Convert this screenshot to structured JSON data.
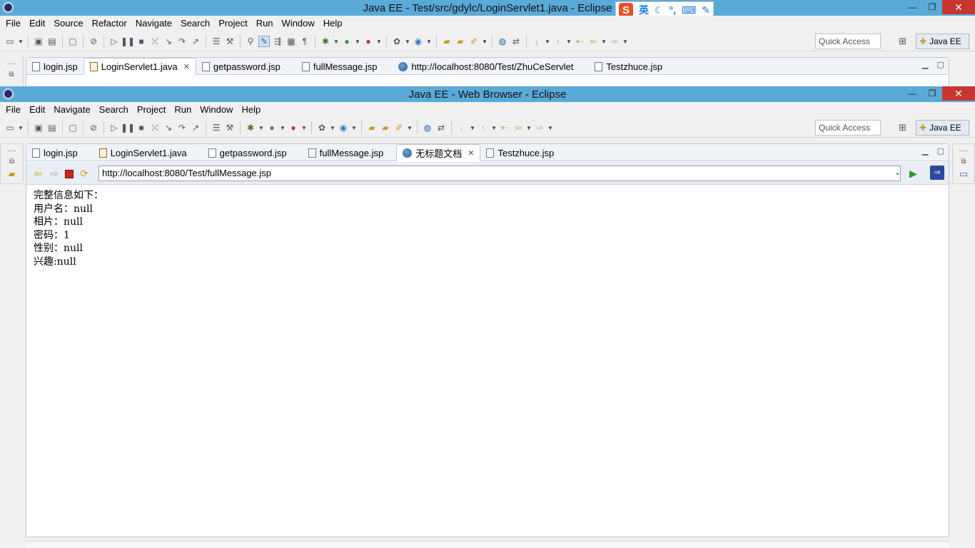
{
  "back_window": {
    "title": "Java EE - Test/src/gdylc/LoginServlet1.java - Eclipse",
    "menu": [
      "File",
      "Edit",
      "Source",
      "Refactor",
      "Navigate",
      "Search",
      "Project",
      "Run",
      "Window",
      "Help"
    ],
    "quick_access": "Quick Access",
    "perspective": "Java EE",
    "tabs": [
      {
        "label": "login.jsp",
        "icon": "jsp-file-icon"
      },
      {
        "label": "LoginServlet1.java",
        "icon": "java-file-icon",
        "active": true
      },
      {
        "label": "getpassword.jsp",
        "icon": "jsp-file-icon"
      },
      {
        "label": "fullMessage.jsp",
        "icon": "jsp-file-icon"
      },
      {
        "label": "http://localhost:8080/Test/ZhuCeServlet",
        "icon": "globe-icon"
      },
      {
        "label": "Testzhuce.jsp",
        "icon": "jsp-file-icon"
      }
    ]
  },
  "ime": {
    "label": "英",
    "logo": "S"
  },
  "front_window": {
    "title": "Java EE - Web Browser - Eclipse",
    "menu": [
      "File",
      "Edit",
      "Navigate",
      "Search",
      "Project",
      "Run",
      "Window",
      "Help"
    ],
    "quick_access": "Quick Access",
    "perspective": "Java EE",
    "tabs": [
      {
        "label": "login.jsp",
        "icon": "jsp-file-icon"
      },
      {
        "label": "LoginServlet1.java",
        "icon": "java-file-icon"
      },
      {
        "label": "getpassword.jsp",
        "icon": "jsp-file-icon"
      },
      {
        "label": "fullMessage.jsp",
        "icon": "jsp-file-icon"
      },
      {
        "label": "无标题文档",
        "icon": "globe-icon",
        "active": true
      },
      {
        "label": "Testzhuce.jsp",
        "icon": "jsp-file-icon"
      }
    ],
    "url": "http://localhost:8080/Test/fullMessage.jsp",
    "page_lines": [
      "完整信息如下：",
      "用户名：null",
      "相片：null",
      "密码：1",
      "性别：null",
      "兴趣:null"
    ]
  },
  "colors": {
    "titlebar_bg": "#5aaad8",
    "close_btn": "#c7372f",
    "active_tab_bg": "#ffffff"
  }
}
